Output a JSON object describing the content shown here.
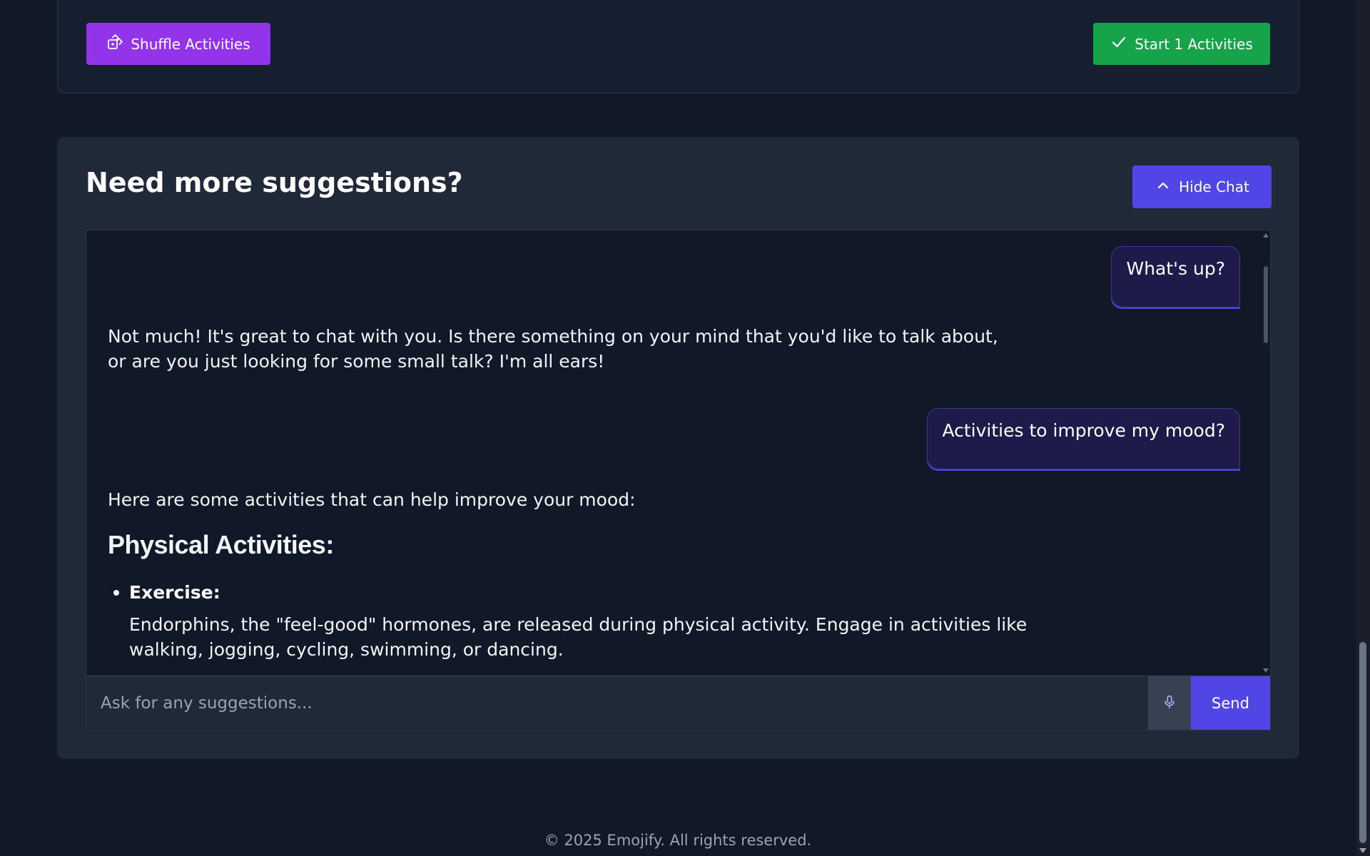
{
  "actions": {
    "shuffle_label": "Shuffle Activities",
    "start_label": "Start 1 Activities"
  },
  "chat": {
    "title": "Need more suggestions?",
    "hide_label": "Hide Chat",
    "messages": [
      {
        "role": "user",
        "text": "What's up?"
      },
      {
        "role": "assistant",
        "text": "Not much! It's great to chat with you. Is there something on your mind that you'd like to talk about, or are you just looking for some small talk? I'm all ears!"
      },
      {
        "role": "user",
        "text": "Activities to improve my mood?"
      },
      {
        "role": "assistant",
        "text": "Here are some activities that can help improve your mood:"
      }
    ],
    "section_heading": "Physical Activities:",
    "list_items": [
      {
        "title": "Exercise:",
        "description": "Endorphins, the \"feel-good\" hormones, are released during physical activity. Engage in activities like walking, jogging, cycling, swimming, or dancing."
      }
    ],
    "input_placeholder": "Ask for any suggestions...",
    "send_label": "Send"
  },
  "footer": {
    "text": "© 2025 Emojify. All rights reserved."
  },
  "icons": {
    "shuffle": "dice-icon",
    "start": "check-icon",
    "hide": "chevron-up-icon",
    "mic": "microphone-icon"
  },
  "colors": {
    "background": "#111827",
    "card": "#1f2937",
    "shuffle_button": "#9333ea",
    "start_button": "#16a34a",
    "accent": "#4f46e5",
    "user_bubble": "#1e1b4b"
  }
}
